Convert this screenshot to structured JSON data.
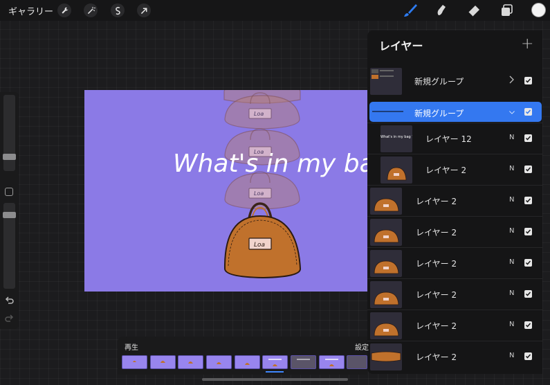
{
  "topbar": {
    "gallery_label": "ギャラリー",
    "left_tools": [
      "wrench-icon",
      "magic-wand-icon",
      "selection-icon",
      "transform-arrow-icon"
    ],
    "right_tools": [
      "brush-icon",
      "smudge-icon",
      "eraser-icon",
      "layers-icon"
    ],
    "active_tool_color": "#2d7bf0",
    "current_color": "#f4f4f4"
  },
  "canvas": {
    "background_color": "#8b7ae6",
    "title_text": "What's in my bag ?",
    "tag_text": "Loa",
    "bag_color": "#c0712c"
  },
  "layers_panel": {
    "title": "レイヤー",
    "add_symbol": "+",
    "rows": [
      {
        "name": "新規グループ",
        "type": "group-collapsed",
        "visible": true
      },
      {
        "name": "新規グループ",
        "type": "group-expanded-selected",
        "visible": true
      },
      {
        "name": "レイヤー 12",
        "blend": "N",
        "visible": true,
        "thumb_text": "What's in my bag ?"
      },
      {
        "name": "レイヤー 2",
        "blend": "N",
        "visible": true
      },
      {
        "name": "レイヤー 2",
        "blend": "N",
        "visible": true
      },
      {
        "name": "レイヤー 2",
        "blend": "N",
        "visible": true
      },
      {
        "name": "レイヤー 2",
        "blend": "N",
        "visible": true
      },
      {
        "name": "レイヤー 2",
        "blend": "N",
        "visible": true
      },
      {
        "name": "レイヤー 2",
        "blend": "N",
        "visible": true
      },
      {
        "name": "レイヤー 2",
        "blend": "N",
        "visible": true
      }
    ]
  },
  "animation": {
    "play_label": "再生",
    "settings_label": "設定"
  }
}
